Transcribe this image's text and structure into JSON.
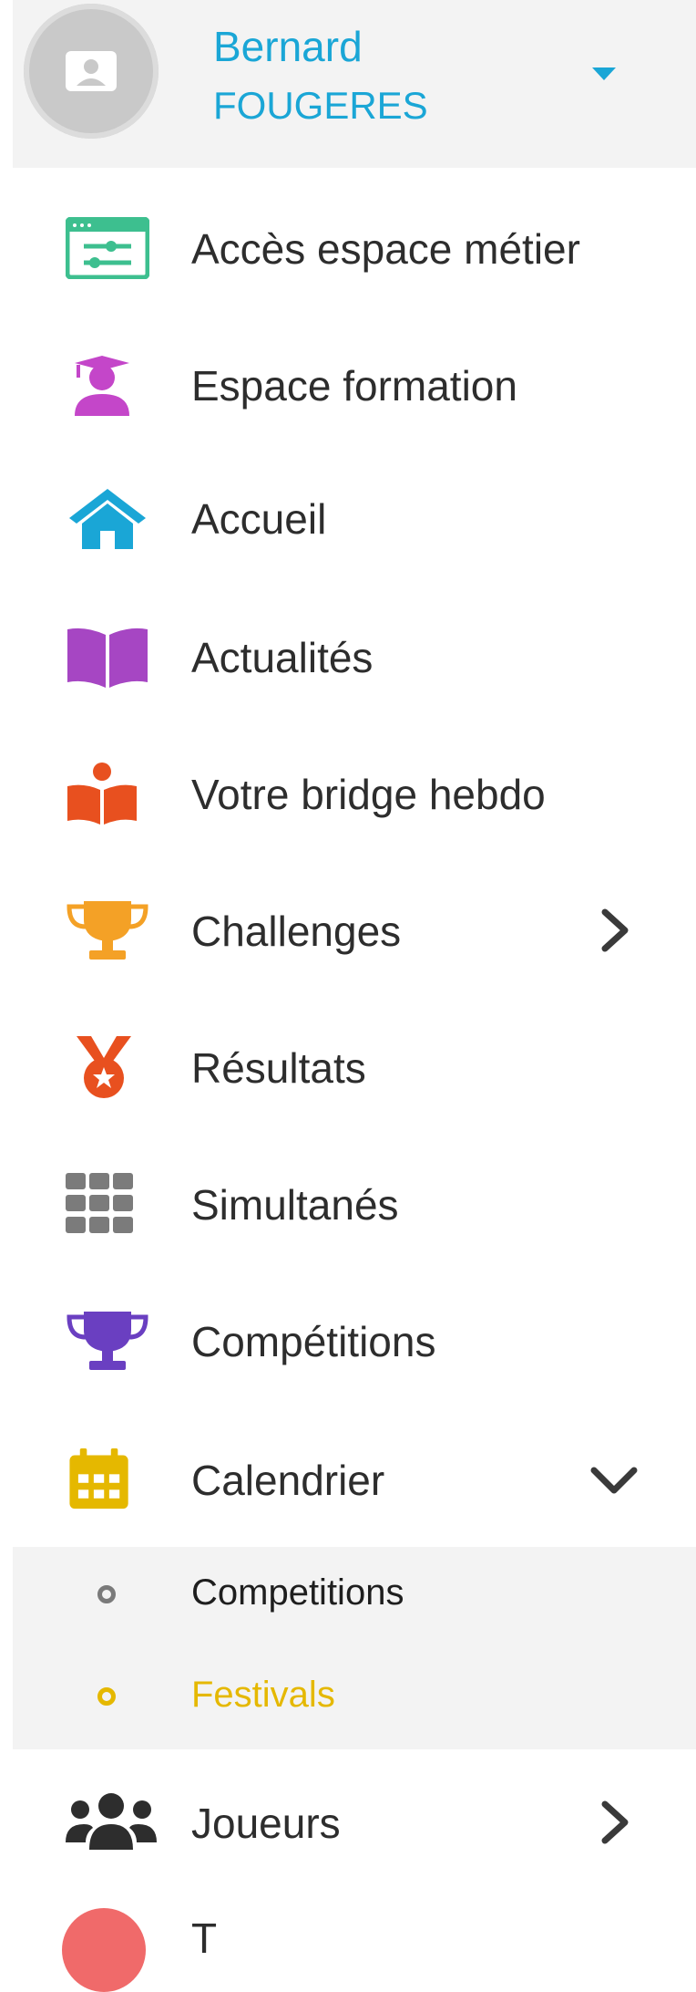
{
  "user": {
    "first_name": "Bernard",
    "last_name": "FOUGERES"
  },
  "menu": [
    {
      "label": "Accès espace métier",
      "icon": "dashboard-settings-icon",
      "color": "#3dbf8f"
    },
    {
      "label": "Espace formation",
      "icon": "graduate-icon",
      "color": "#c446c9"
    },
    {
      "label": "Accueil",
      "icon": "home-icon",
      "color": "#1aa6d6"
    },
    {
      "label": "Actualités",
      "icon": "book-open-icon",
      "color": "#a646c3"
    },
    {
      "label": "Votre bridge hebdo",
      "icon": "reader-icon",
      "color": "#e8501f"
    },
    {
      "label": "Challenges",
      "icon": "trophy-icon",
      "color": "#f4a126",
      "expandable": true
    },
    {
      "label": "Résultats",
      "icon": "medal-icon",
      "color": "#e8501f"
    },
    {
      "label": "Simultanés",
      "icon": "grid-icon",
      "color": "#7b7b7b"
    },
    {
      "label": "Compétitions",
      "icon": "trophy-icon",
      "color": "#6a3fc1"
    },
    {
      "label": "Calendrier",
      "icon": "calendar-icon",
      "color": "#e5b800",
      "expanded": true
    }
  ],
  "calendar_submenu": [
    {
      "label": "Competitions"
    },
    {
      "label": "Festivals",
      "active": true
    }
  ],
  "menu_after": [
    {
      "label": "Joueurs",
      "icon": "users-icon",
      "color": "#2d2d2d",
      "expandable": true
    }
  ],
  "partial_item": {
    "label": "T",
    "icon": "paper-plane-icon",
    "color": "#f06a6a"
  }
}
